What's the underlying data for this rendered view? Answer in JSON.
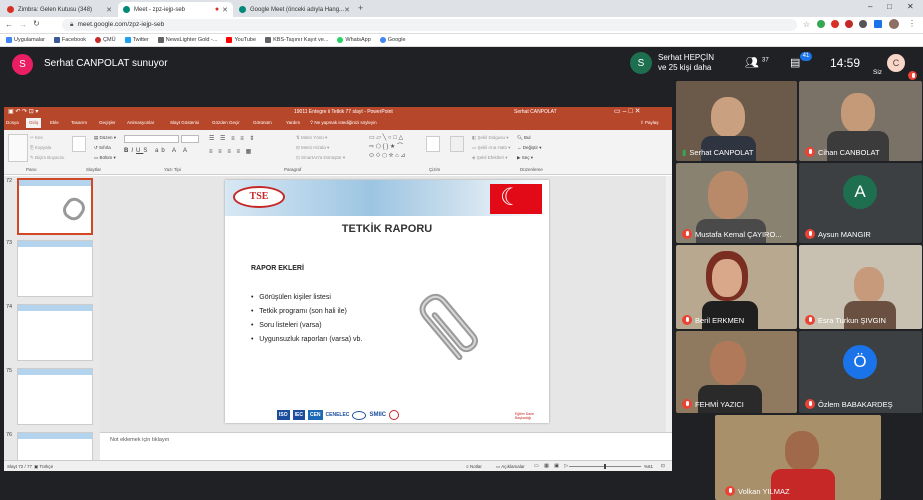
{
  "browser": {
    "tabs": [
      {
        "label": "Zimbra: Gelen Kutusu (348)",
        "color": "#d93025"
      },
      {
        "label": "Meet - zpz-iejp-seb",
        "color": "#00897b"
      },
      {
        "label": "Google Meet (önceki adıyla Hang...",
        "color": "#00897b"
      }
    ],
    "url": "meet.google.com/zpz-iejp-seb",
    "bookmarks": [
      {
        "label": "Uygulamalar",
        "color": "#4285f4"
      },
      {
        "label": "Facebook",
        "color": "#3b5998"
      },
      {
        "label": "ÇMÜ",
        "color": "#c62828"
      },
      {
        "label": "Twitter",
        "color": "#1da1f2"
      },
      {
        "label": "NewsLighter Gold -...",
        "color": "#5f6368"
      },
      {
        "label": "YouTube",
        "color": "#ff0000"
      },
      {
        "label": "KBS-Taşınır Kayıt ve...",
        "color": "#5f6368"
      },
      {
        "label": "WhatsApp",
        "color": "#25d366"
      },
      {
        "label": "Google",
        "color": "#4285f4"
      }
    ]
  },
  "meet": {
    "presenter_initial": "S",
    "presenter_text": "Serhat CANPOLAT sunuyor",
    "host_initial": "S",
    "host_line1": "Serhat HEPÇİN",
    "host_line2": "ve 25 kişi daha",
    "people_count": "37",
    "chat_count": "41",
    "time": "14:59",
    "self_label": "Siz",
    "self_initial": "C"
  },
  "ppt": {
    "title": "19011 Entegre ii Tetkik 77 slayt  -  PowerPoint",
    "user": "Serhat CANPOLAT",
    "ribbon_tabs": [
      "Dosya",
      "Giriş",
      "Ekle",
      "Tasarım",
      "Geçişler",
      "Animasyonlar",
      "Slayt Gösterisi",
      "Gözden Geçir",
      "Görünüm",
      "Yardım"
    ],
    "tell_me": "Ne yapmak istediğinizi söyleyin",
    "share": "Paylaş",
    "groups": [
      "Pano",
      "Slaytlar",
      "Yazı Tipi",
      "Paragraf",
      "Çizim",
      "Düzenleme"
    ],
    "thumbs": [
      "72",
      "73",
      "74",
      "75",
      "76"
    ],
    "slide": {
      "title": "TETKİK RAPORU",
      "subtitle": "RAPOR EKLERİ",
      "bullets": [
        "Görüşülen kişiler listesi",
        "Tetkik programı (son hali ile)",
        "Soru listeleri (varsa)",
        "Uygunsuzluk raporları (varsa) vb."
      ],
      "logo_tse": "TSE",
      "footer_logos": [
        "ISO",
        "IEC",
        "CEN",
        "CENELEC",
        "SMIIC"
      ],
      "footer_right": "Eğitim Daire Başkanlığı"
    },
    "notes": "Not eklemek için tıklayın",
    "status_left": "Slayt 72 / 77",
    "status_lang": "Türkçe",
    "status_notes": "Notlar",
    "status_comments": "Açıklamalar",
    "zoom": "%61"
  },
  "participants": [
    {
      "name": "Serhat CANPOLAT",
      "muted": false,
      "type": "video",
      "bg": "#6b5a4a"
    },
    {
      "name": "Cihan CANBOLAT",
      "muted": true,
      "type": "video",
      "bg": "#7a7266"
    },
    {
      "name": "Mustafa Kemal ÇAYIRO...",
      "muted": true,
      "type": "video",
      "bg": "#8a8270"
    },
    {
      "name": "Aysun MANGIR",
      "muted": true,
      "type": "avatar",
      "initial": "A",
      "avatar_color": "#1e6f50"
    },
    {
      "name": "Beril ERKMEN",
      "muted": true,
      "type": "video",
      "bg": "#b8a890"
    },
    {
      "name": "Esra Turkun ŞIVGIN",
      "muted": true,
      "type": "video",
      "bg": "#c8c0b0"
    },
    {
      "name": "FEHMİ YAZICI",
      "muted": true,
      "type": "video",
      "bg": "#8f7a60"
    },
    {
      "name": "Özlem BABAKARDEŞ",
      "muted": true,
      "type": "avatar",
      "initial": "Ö",
      "avatar_color": "#1a73e8"
    },
    {
      "name": "Volkan YILMAZ",
      "muted": true,
      "type": "video",
      "bg": "#a8906a"
    }
  ]
}
